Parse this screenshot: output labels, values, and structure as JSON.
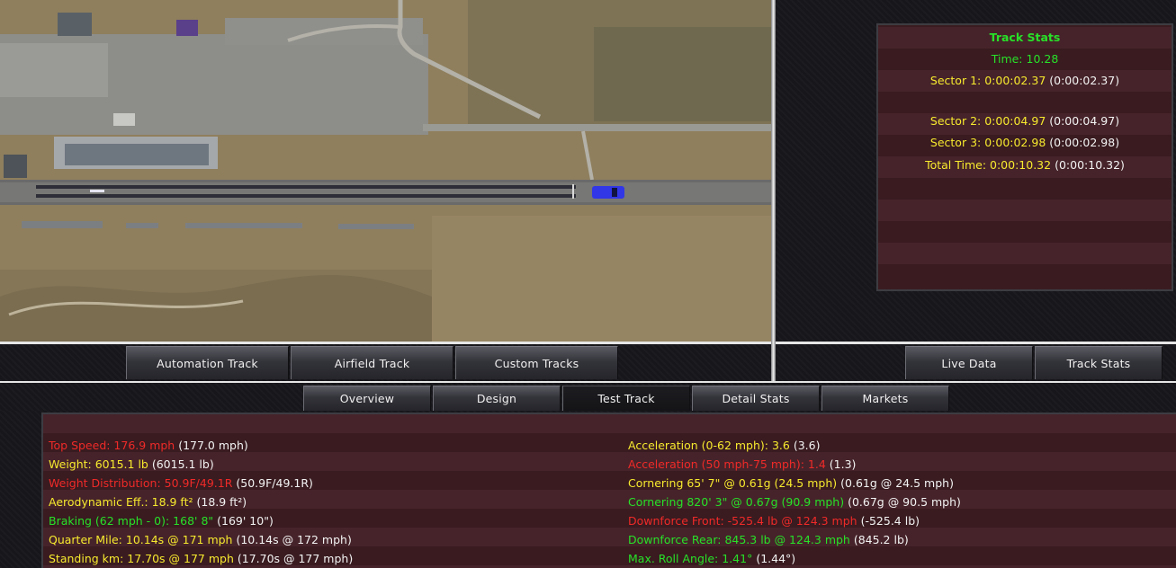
{
  "track_stats": {
    "title": "Track Stats",
    "time": "Time: 10.28",
    "sector1": "Sector 1: 0:00:02.37",
    "sector1_ref": "(0:00:02.37)",
    "sector2": "Sector 2: 0:00:04.97",
    "sector2_ref": "(0:00:04.97)",
    "sector3": "Sector 3: 0:00:02.98",
    "sector3_ref": "(0:00:02.98)",
    "total": "Total Time: 0:00:10.32",
    "total_ref": "(0:00:10.32)"
  },
  "track_tabs": [
    "Automation Track",
    "Airfield Track",
    "Custom Tracks"
  ],
  "view_tabs": [
    "Live Data",
    "Track Stats"
  ],
  "main_tabs": [
    "Overview",
    "Design",
    "Test Track",
    "Detail Stats",
    "Markets"
  ],
  "left_stats": [
    {
      "label": "Top Speed: 176.9 mph",
      "ref": "(177.0 mph)",
      "color": "red"
    },
    {
      "label": "Weight: 6015.1 lb",
      "ref": "(6015.1 lb)",
      "color": "yellow"
    },
    {
      "label": "Weight Distribution: 50.9F/49.1R",
      "ref": "(50.9F/49.1R)",
      "color": "red"
    },
    {
      "label": "Aerodynamic Eff.: 18.9 ft²",
      "ref": "(18.9 ft²)",
      "color": "yellow"
    },
    {
      "label": "Braking (62 mph - 0): 168' 8\"",
      "ref": "(169' 10\")",
      "color": "green"
    },
    {
      "label": "Quarter Mile: 10.14s @ 171 mph",
      "ref": "(10.14s @ 172 mph)",
      "color": "yellow"
    },
    {
      "label": "Standing km: 17.70s @ 177 mph",
      "ref": "(17.70s @ 177 mph)",
      "color": "yellow"
    }
  ],
  "right_stats": [
    {
      "label": "Acceleration (0-62 mph): 3.6",
      "ref": "(3.6)",
      "color": "yellow"
    },
    {
      "label": "Acceleration (50 mph-75 mph): 1.4",
      "ref": "(1.3)",
      "color": "red"
    },
    {
      "label": "Cornering 65' 7\" @ 0.61g (24.5 mph)",
      "ref": "(0.61g @ 24.5 mph)",
      "color": "yellow"
    },
    {
      "label": "Cornering 820' 3\" @ 0.67g (90.9 mph)",
      "ref": "(0.67g @ 90.5 mph)",
      "color": "green"
    },
    {
      "label": "Downforce Front: -525.4 lb @ 124.3 mph",
      "ref": "(-525.4 lb)",
      "color": "red"
    },
    {
      "label": "Downforce Rear: 845.3 lb @ 124.3 mph",
      "ref": "(845.2 lb)",
      "color": "green"
    },
    {
      "label": "Max. Roll Angle: 1.41°",
      "ref": "(1.44°)",
      "color": "green"
    }
  ]
}
